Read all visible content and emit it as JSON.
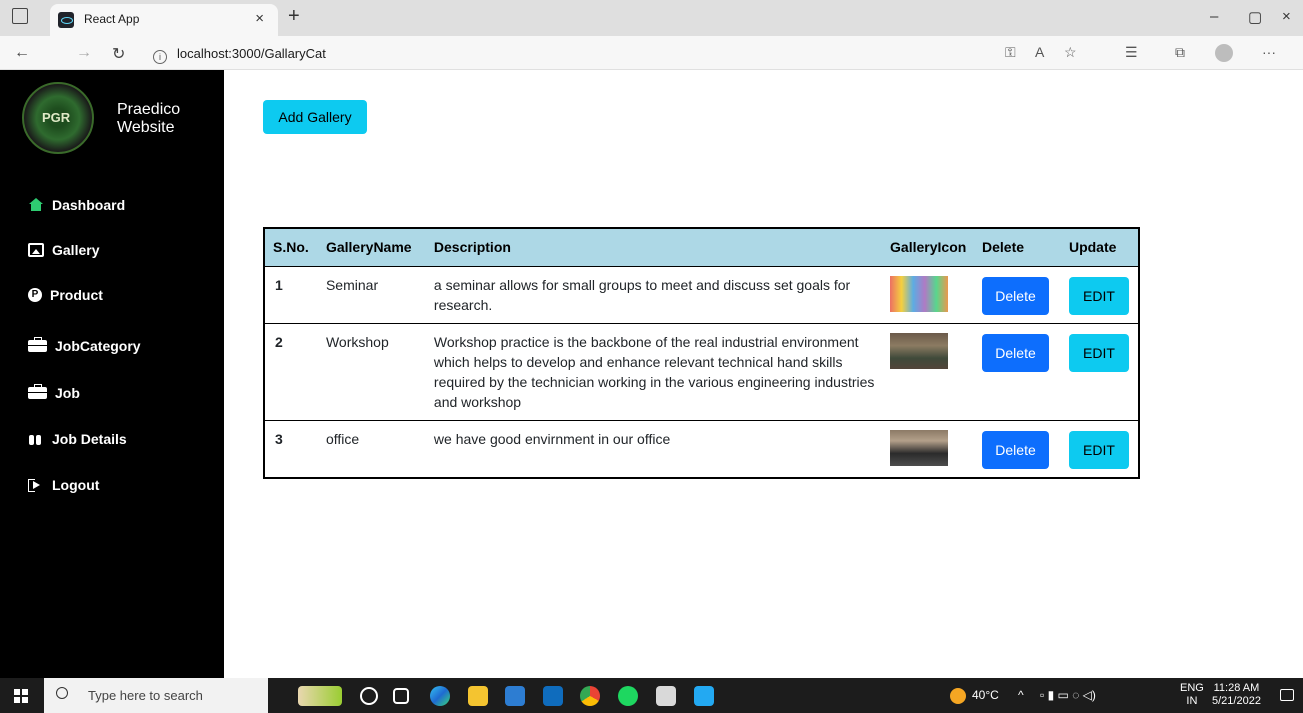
{
  "browser": {
    "tab_title": "React App",
    "tab_close": "×",
    "new_tab": "+",
    "url": "localhost:3000/GallaryCat",
    "window_controls": [
      "–",
      "▢",
      "×"
    ]
  },
  "sidebar": {
    "brand_line1": "Praedico",
    "brand_line2": "Website",
    "items": [
      {
        "label": "Dashboard",
        "icon": "home-icon"
      },
      {
        "label": "Gallery",
        "icon": "image-icon"
      },
      {
        "label": "Product",
        "icon": "product-p-icon"
      },
      {
        "label": "JobCategory",
        "icon": "briefcase-icon"
      },
      {
        "label": "Job",
        "icon": "briefcase-icon"
      },
      {
        "label": "Job Details",
        "icon": "binoculars-icon"
      },
      {
        "label": "Logout",
        "icon": "logout-icon"
      }
    ]
  },
  "main": {
    "add_button": "Add Gallery",
    "table": {
      "headers": [
        "S.No.",
        "GalleryName",
        "Description",
        "GalleryIcon",
        "Delete",
        "Update"
      ],
      "rows": [
        {
          "sno": "1",
          "name": "Seminar",
          "description": "a seminar allows for small groups to meet and discuss set goals for research.",
          "delete": "Delete",
          "edit": "EDIT"
        },
        {
          "sno": "2",
          "name": "Workshop",
          "description": "Workshop practice is the backbone of the real industrial environment which helps to develop and enhance relevant technical hand skills required by the technician working in the various engineering industries and workshop",
          "delete": "Delete",
          "edit": "EDIT"
        },
        {
          "sno": "3",
          "name": "office",
          "description": "we have good envirnment in our office",
          "delete": "Delete",
          "edit": "EDIT"
        }
      ]
    }
  },
  "taskbar": {
    "search_placeholder": "Type here to search",
    "temperature": "40°C",
    "language": "ENG",
    "region": "IN",
    "time": "11:28 AM",
    "date": "5/21/2022"
  },
  "colors": {
    "sidebar_bg": "#000000",
    "table_header_bg": "#add8e6",
    "delete_button": "#0d6efd",
    "edit_button": "#0dcaf0",
    "dashboard_icon": "#2ecc71"
  }
}
